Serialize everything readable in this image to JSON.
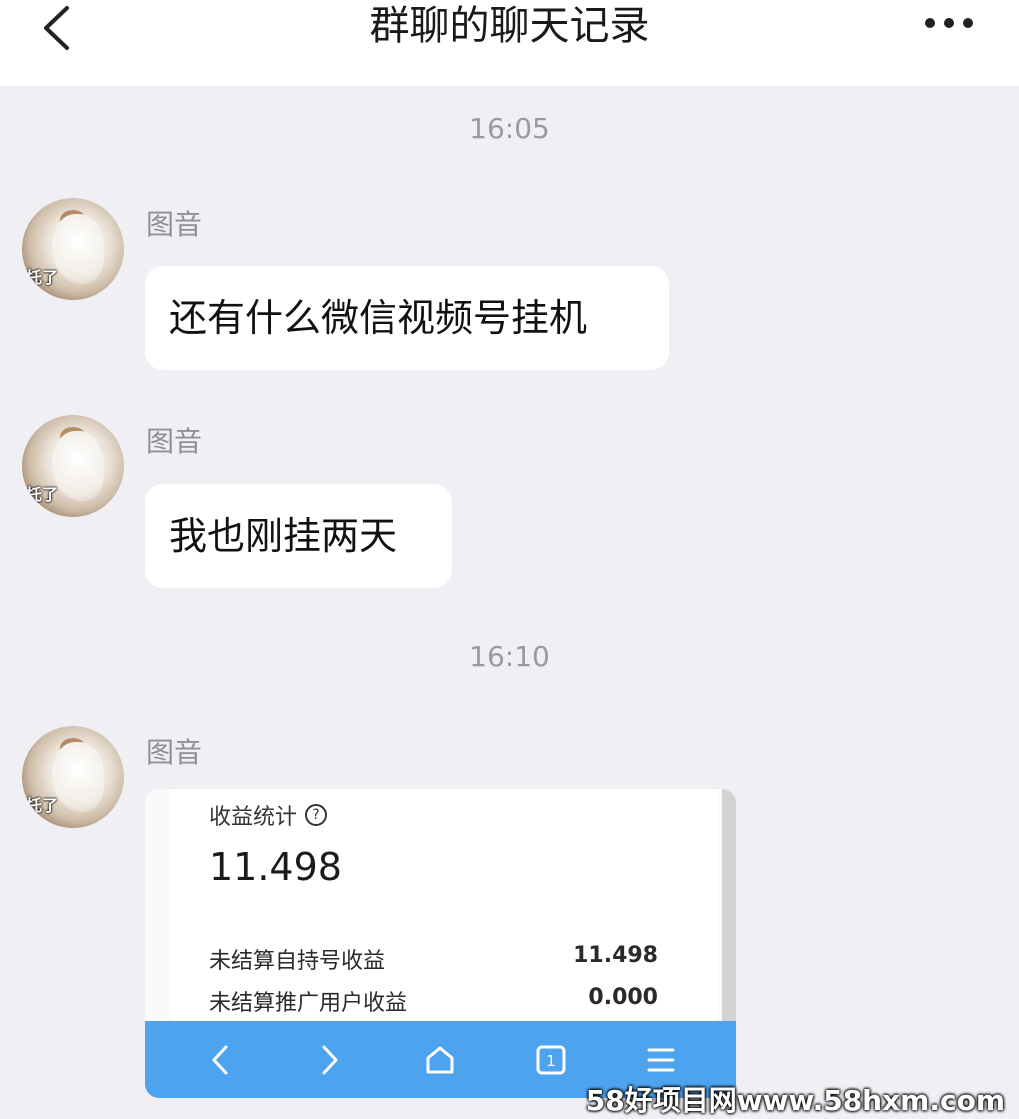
{
  "header": {
    "title": "群聊的聊天记录",
    "back_icon": "chevron-left-icon",
    "more_icon": "more-horizontal-icon"
  },
  "messages": [
    {
      "timestamp": "16:05"
    },
    {
      "sender": "图音",
      "avatar_caption": "托了",
      "text": "还有什么微信视频号挂机"
    },
    {
      "sender": "图音",
      "avatar_caption": "托了",
      "text": "我也刚挂两天"
    },
    {
      "timestamp": "16:10"
    },
    {
      "sender": "图音",
      "avatar_caption": "托了",
      "image": {
        "stat_title": "收益统计",
        "help_icon_glyph": "?",
        "total": "11.498",
        "rows": [
          {
            "label": "未结算自持号收益",
            "value": "11.498"
          },
          {
            "label": "未结算推广用户收益",
            "value": "0.000"
          }
        ],
        "toolbar": {
          "back_icon": "chevron-left-icon",
          "forward_icon": "chevron-right-icon",
          "home_icon": "home-icon",
          "tabs_count": "1",
          "menu_icon": "menu-icon",
          "accent": "#4ea3ef"
        }
      }
    }
  ],
  "watermark": "58好项目网www.58hxm.com",
  "colors": {
    "background": "#efeff4",
    "bubble": "#ffffff",
    "timestamp": "#9a9a9f"
  }
}
